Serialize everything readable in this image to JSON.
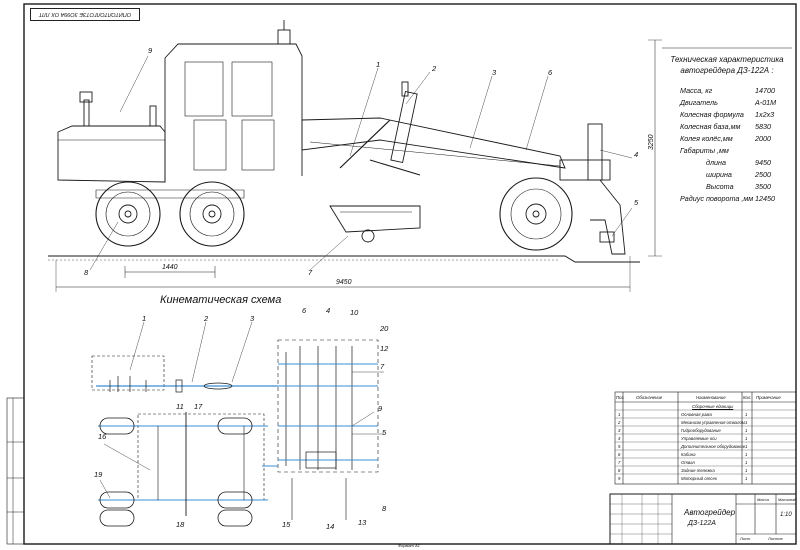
{
  "stamp": "ОПИТОЛТОЛГОТЗЕ 3О99А ОХ ЛЛТ",
  "spec": {
    "title": "Техническая характеристика автогрейдера ДЗ-122А :",
    "rows": [
      {
        "label": "Масса, кг",
        "value": "14700"
      },
      {
        "label": "Двигатель",
        "value": "А-01М"
      },
      {
        "label": "Колесная формула",
        "value": "1х2х3"
      },
      {
        "label": "Колесная база,мм",
        "value": "5830"
      },
      {
        "label": "Колея колёс,мм",
        "value": "2000"
      },
      {
        "label": "Габариты ,мм",
        "value": ""
      },
      {
        "label": "длина",
        "value": "9450"
      },
      {
        "label": "ширина",
        "value": "2500"
      },
      {
        "label": "Высота",
        "value": "3500"
      },
      {
        "label": "Радиус поворота ,мм",
        "value": "12450"
      }
    ]
  },
  "side_view": {
    "callouts": [
      "1",
      "2",
      "3",
      "6",
      "9",
      "4",
      "5",
      "8",
      "7"
    ],
    "dims": {
      "height": "3250",
      "span": "1440",
      "length": "9450"
    }
  },
  "kinematic": {
    "title": "Кинематическая схема",
    "callouts": [
      "1",
      "2",
      "3",
      "6",
      "4",
      "10",
      "20",
      "12",
      "7",
      "9",
      "5",
      "16",
      "11",
      "17",
      "19",
      "18",
      "15",
      "14",
      "13",
      "8"
    ]
  },
  "parts_list": {
    "headers": [
      "Поз.",
      "Обозначение",
      "Наименование",
      "Кол.",
      "Примечание"
    ],
    "section": "Сборочные единицы",
    "rows": [
      {
        "pos": "1",
        "name": "Основная рама",
        "qty": "1"
      },
      {
        "pos": "2",
        "name": "Механизм управления отвалом",
        "qty": "1"
      },
      {
        "pos": "3",
        "name": "Гидрооборудование",
        "qty": "1"
      },
      {
        "pos": "4",
        "name": "Управляемые оси",
        "qty": "1"
      },
      {
        "pos": "5",
        "name": "Дополнительное оборудование",
        "qty": "1"
      },
      {
        "pos": "6",
        "name": "Кабина",
        "qty": "1"
      },
      {
        "pos": "7",
        "name": "Отвал",
        "qty": "1"
      },
      {
        "pos": "8",
        "name": "Задние тележка",
        "qty": "1"
      },
      {
        "pos": "9",
        "name": "Моторный отсек",
        "qty": "1"
      }
    ]
  },
  "title_block": {
    "name": "Автогрейдер",
    "model": "ДЗ-122А",
    "scale_label": "Масштаб",
    "scale": "1:10",
    "mass_label": "Масса",
    "sheet": "Лист",
    "sheets": "Листов"
  },
  "footer": "Формат А1"
}
